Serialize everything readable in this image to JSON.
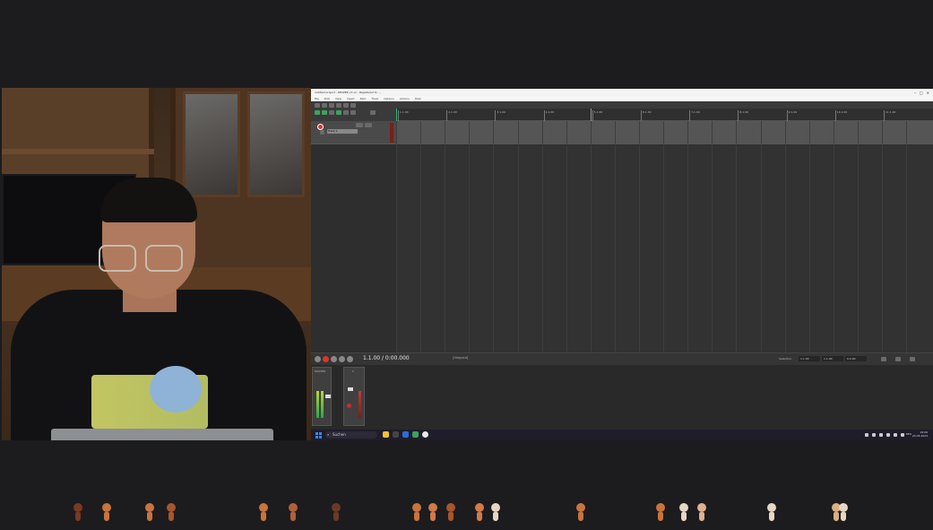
{
  "window": {
    "title": "untitled project - REAPER v7.xx - Registered to ...",
    "menu": [
      "File",
      "Edit",
      "View",
      "Insert",
      "Item",
      "Track",
      "Options",
      "Actions",
      "Help"
    ]
  },
  "ruler": {
    "labels": [
      "1.1.00",
      "2.1.00",
      "3.1.00",
      "4.1.00",
      "5.1.00",
      "6.1.00",
      "7.1.00",
      "8.1.00",
      "9.1.00",
      "10.1.00",
      "11.1.00"
    ]
  },
  "track": {
    "name": "Track 1"
  },
  "transport": {
    "position": "1.1.00 / 0:00.000",
    "status": "[Stopped]"
  },
  "selection": {
    "label": "Selection:",
    "start": "1.1.00",
    "end": "1.1.00",
    "length": "0.0.00"
  },
  "mixer": {
    "master_label": "MASTER",
    "track_label": "1"
  },
  "taskbar": {
    "search_placeholder": "Suchen",
    "tray_time": "19:06",
    "tray_date": "24.03.2024",
    "tray_lang": "DEU"
  },
  "colors": {
    "accent_green": "#2bb673",
    "record_red": "#d9362f",
    "taskbar": "#1f1c2b"
  },
  "emotes": [
    {
      "color": "#7a3a22"
    },
    {
      "color": "#c8743e"
    },
    {
      "color": "#c8743e"
    },
    {
      "color": "#a8562c"
    },
    {
      "color": "#c8743e"
    },
    {
      "color": "#b0603a"
    },
    {
      "color": "#6a3a28"
    },
    {
      "color": "#c8743e"
    },
    {
      "color": "#d17a4a"
    },
    {
      "color": "#a8562c"
    },
    {
      "color": "#d17a4a"
    },
    {
      "color": "#e8d6c4"
    },
    {
      "color": "#c8743e"
    },
    {
      "color": "#c8743e"
    },
    {
      "color": "#e8d6c4"
    },
    {
      "color": "#e0b090"
    },
    {
      "color": "#e8d6c4"
    },
    {
      "color": "#d9b080"
    },
    {
      "color": "#e8d6c4"
    }
  ]
}
